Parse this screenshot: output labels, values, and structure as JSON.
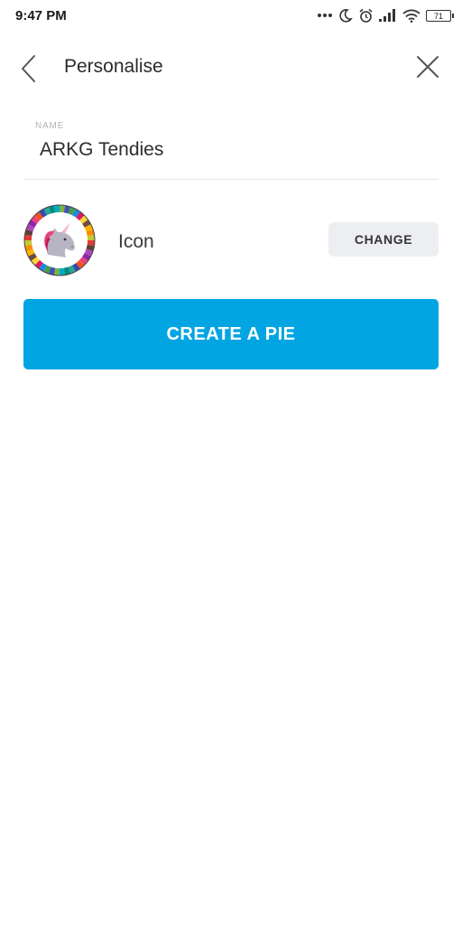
{
  "status_bar": {
    "time": "9:47 PM",
    "battery": "71",
    "icons": [
      "more-dots-icon",
      "moon-icon",
      "alarm-icon",
      "signal-icon",
      "wifi-icon",
      "battery-icon"
    ]
  },
  "header": {
    "title": "Personalise",
    "back_icon": "chevron-left-icon",
    "close_icon": "close-icon"
  },
  "name_field": {
    "label": "NAME",
    "value": "ARKG Tendies"
  },
  "icon_row": {
    "label": "Icon",
    "avatar_icon": "unicorn-icon",
    "change_label": "CHANGE"
  },
  "create_button": {
    "label": "CREATE A PIE"
  },
  "colors": {
    "accent": "#00a5e2",
    "change_bg": "#edeef2",
    "divider": "#e6e6e6"
  }
}
